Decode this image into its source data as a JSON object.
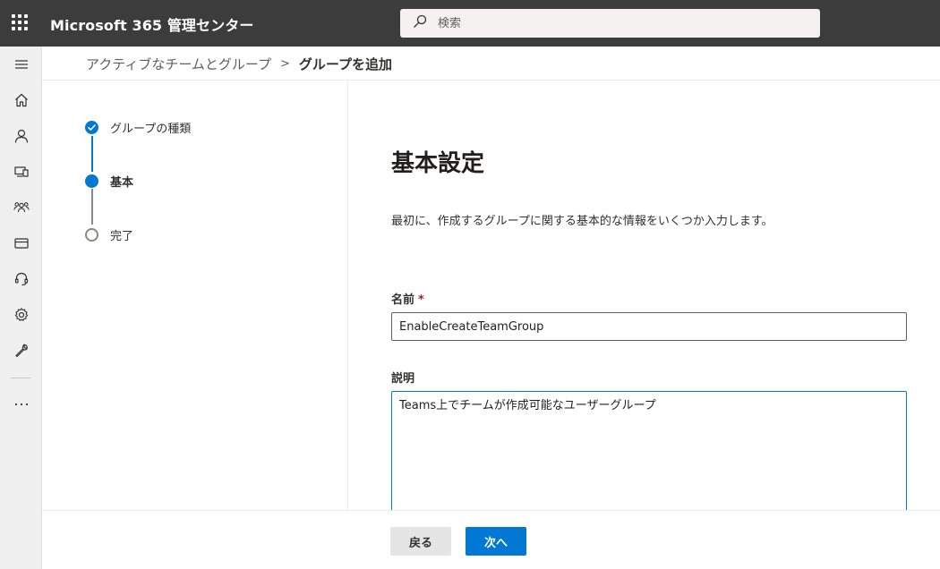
{
  "header": {
    "app_title": "Microsoft 365 管理センター",
    "search_placeholder": "検索"
  },
  "breadcrumb": {
    "parent": "アクティブなチームとグループ",
    "separator": ">",
    "current": "グループを追加"
  },
  "wizard": {
    "steps": [
      {
        "label": "グループの種類",
        "state": "completed"
      },
      {
        "label": "基本",
        "state": "current"
      },
      {
        "label": "完了",
        "state": "pending"
      }
    ]
  },
  "form": {
    "heading": "基本設定",
    "description": "最初に、作成するグループに関する基本的な情報をいくつか入力します。",
    "name_label": "名前",
    "required_mark": "*",
    "name_value": "EnableCreateTeamGroup",
    "desc_label": "説明",
    "desc_value": "Teams上でチームが作成可能なユーザーグループ"
  },
  "footer": {
    "back_label": "戻る",
    "next_label": "次へ"
  },
  "rail_icons": [
    "menu-icon",
    "home-icon",
    "user-icon",
    "devices-icon",
    "groups-icon",
    "billing-icon",
    "support-icon",
    "settings-icon",
    "setup-icon",
    "more-icon"
  ],
  "colors": {
    "topbar": "#3c3c3c",
    "accent": "#0078d4",
    "rail": "#f0f0f0",
    "required": "#a4262c"
  }
}
